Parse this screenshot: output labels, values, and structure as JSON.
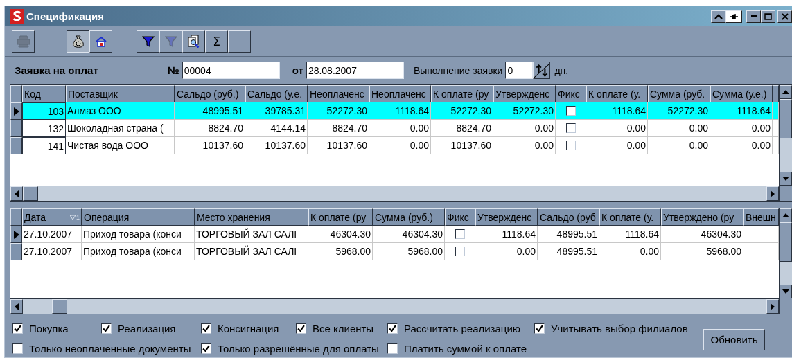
{
  "window": {
    "title": "Спецификация"
  },
  "toolbar": {
    "groups": [
      {
        "buttons": [
          {
            "kind": "printer",
            "pressed": false,
            "disabled": true
          }
        ]
      },
      {
        "buttons": [
          {
            "kind": "bag",
            "pressed": true,
            "disabled": false
          },
          {
            "kind": "house",
            "pressed": false,
            "disabled": false
          }
        ]
      },
      {
        "buttons": [
          {
            "kind": "filter",
            "pressed": false,
            "disabled": false
          },
          {
            "kind": "filter",
            "pressed": false,
            "disabled": true
          },
          {
            "kind": "find",
            "pressed": false,
            "disabled": false
          },
          {
            "kind": "text",
            "label": "Σ",
            "pressed": false,
            "disabled": false
          },
          {
            "kind": "blank",
            "pressed": false
          }
        ]
      }
    ]
  },
  "form": {
    "title": "Заявка на оплат",
    "number_label": "№",
    "number": "00004",
    "date_label": "от",
    "date": "28.08.2007",
    "execution_label": "Выполнение заявки",
    "execution_value": "0",
    "days_unit": "дн."
  },
  "top_table": {
    "focused": true,
    "columns": [
      {
        "label": "Код",
        "kind": "num"
      },
      {
        "label": "Поставщик",
        "kind": "text"
      },
      {
        "label": "Сальдо (руб.)",
        "kind": "num"
      },
      {
        "label": "Сальдо (у.е.",
        "kind": "num"
      },
      {
        "label": "Неоплаченс",
        "kind": "num"
      },
      {
        "label": "Неоплаченс",
        "kind": "num"
      },
      {
        "label": "К оплате (ру",
        "kind": "num"
      },
      {
        "label": "Утвержденс",
        "kind": "num"
      },
      {
        "label": "Фикс",
        "kind": "check"
      },
      {
        "label": "К оплате (у.",
        "kind": "num"
      },
      {
        "label": "Сумма (руб.",
        "kind": "num"
      },
      {
        "label": "Сумма (у.е.)",
        "kind": "num"
      }
    ],
    "rows": [
      {
        "selected": true,
        "cells": [
          "103",
          "Алмаз ООО",
          "48995.51",
          "39785.31",
          "52272.30",
          "1118.64",
          "52272.30",
          "52272.30",
          {
            "checked": false
          },
          "1118.64",
          "52272.30",
          "1118.64"
        ]
      },
      {
        "selected": false,
        "cells": [
          "132",
          "Шоколадная страна (",
          "8824.70",
          "4144.14",
          "8824.70",
          "0.00",
          "8824.70",
          "0.00",
          {
            "checked": false
          },
          "0.00",
          "0.00",
          "0.00"
        ]
      },
      {
        "selected": false,
        "cells": [
          "141",
          "Чистая вода ООО",
          "10137.60",
          "10137.60",
          "10137.60",
          "0.00",
          "10137.60",
          "0.00",
          {
            "checked": false
          },
          "0.00",
          "0.00",
          "0.00"
        ]
      }
    ]
  },
  "bottom_table": {
    "focused": false,
    "columns": [
      {
        "label": "Дата",
        "kind": "text",
        "sort_order": "1"
      },
      {
        "label": "Операция",
        "kind": "text"
      },
      {
        "label": "Место хранения",
        "kind": "text"
      },
      {
        "label": "К оплате (ру",
        "kind": "num"
      },
      {
        "label": "Сумма (руб.)",
        "kind": "num"
      },
      {
        "label": "Фикс",
        "kind": "check"
      },
      {
        "label": "Утвержденс",
        "kind": "num"
      },
      {
        "label": "Сальдо (руб",
        "kind": "num"
      },
      {
        "label": "К оплате (у.",
        "kind": "num"
      },
      {
        "label": "Утверждено (ру",
        "kind": "num"
      },
      {
        "label": "Внешн",
        "kind": "text"
      }
    ],
    "rows": [
      {
        "selected": true,
        "cells": [
          "27.10.2007",
          "Приход товара (конси",
          "ТОРГОВЫЙ ЗАЛ САЛІ",
          "46304.30",
          "46304.30",
          {
            "checked": false
          },
          "1118.64",
          "48995.51",
          "1118.64",
          "46304.30"
        ]
      },
      {
        "selected": false,
        "cells": [
          "27.10.2007",
          "Приход товара (конси",
          "ТОРГОВЫЙ ЗАЛ САЛІ",
          "5968.00",
          "5968.00",
          {
            "checked": false
          },
          "0.00",
          "48995.51",
          "0.00",
          "5968.00"
        ]
      }
    ]
  },
  "option_rows": [
    {
      "options": [
        {
          "label": "Покупка",
          "checked": true
        },
        {
          "label": "Реализация",
          "checked": true
        },
        {
          "label": "Консигнация",
          "checked": true
        },
        {
          "label": "Все клиенты",
          "checked": true
        },
        {
          "label": "Рассчитать реализацию",
          "checked": true
        },
        {
          "label": "Учитывать выбор филиалов",
          "checked": true
        }
      ]
    },
    {
      "options": [
        {
          "label": "Только неоплаченные документы",
          "checked": false
        },
        {
          "label": "Только разрешённые для оплаты",
          "checked": true
        },
        {
          "label": "Платить суммой к оплате",
          "checked": false
        }
      ]
    }
  ],
  "refresh_button": "Обновить"
}
